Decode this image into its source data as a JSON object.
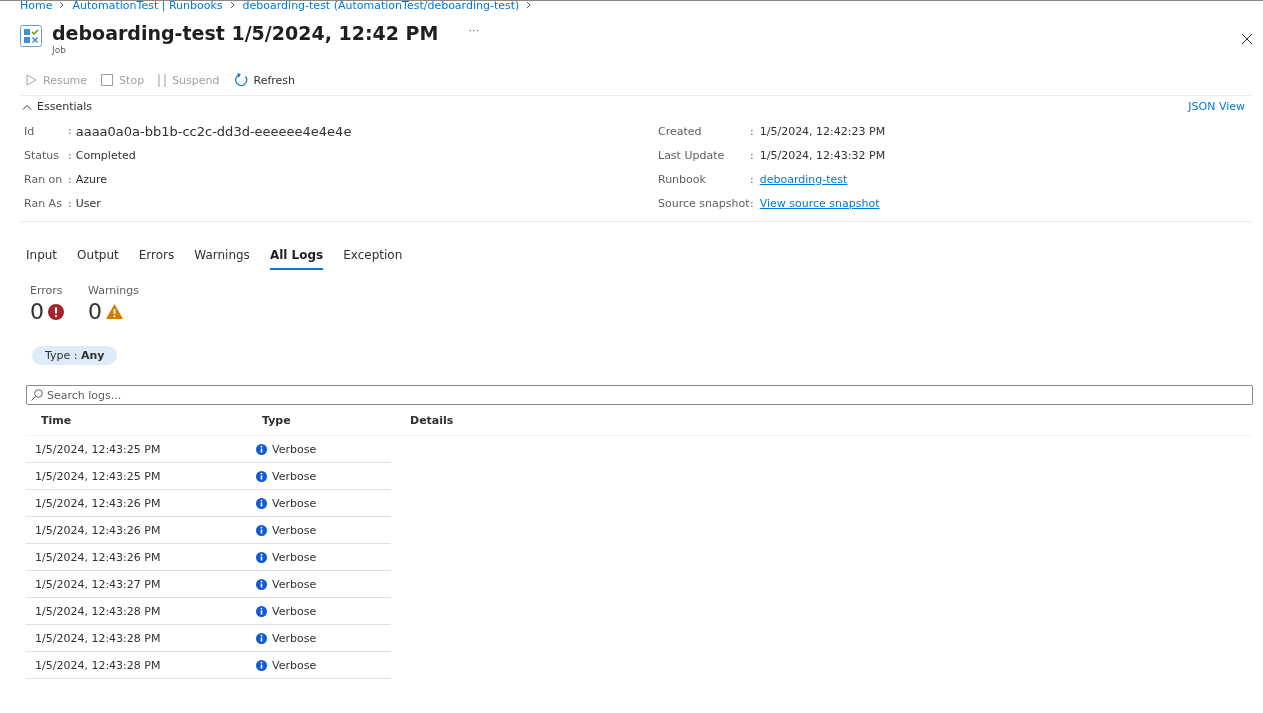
{
  "breadcrumb": [
    "Home",
    "AutomationTest | Runbooks",
    "deboarding-test (AutomationTest/deboarding-test)"
  ],
  "header": {
    "title": "deboarding-test 1/5/2024, 12:42 PM",
    "subtitle": "Job",
    "more": "···"
  },
  "toolbar": [
    {
      "kind": "resume",
      "label": "Resume",
      "disabled": true
    },
    {
      "kind": "stop",
      "label": "Stop",
      "disabled": true
    },
    {
      "kind": "suspend",
      "label": "Suspend",
      "disabled": true
    },
    {
      "kind": "refresh",
      "label": "Refresh",
      "disabled": false
    }
  ],
  "essentials": {
    "label": "Essentials",
    "expanded": true,
    "json_view": "JSON View",
    "separator": ":",
    "left": [
      {
        "label": "Id",
        "value": "aaaa0a0a-bb1b-cc2c-dd3d-eeeeee4e4e4e",
        "kind": "id"
      },
      {
        "label": "Status",
        "value": "Completed",
        "kind": "text"
      },
      {
        "label": "Ran on",
        "value": "Azure",
        "kind": "text"
      },
      {
        "label": "Ran As",
        "value": "User",
        "kind": "text"
      }
    ],
    "right": [
      {
        "label": "Created",
        "value": "1/5/2024, 12:42:23 PM",
        "kind": "text"
      },
      {
        "label": "Last Update",
        "value": "1/5/2024, 12:43:32 PM",
        "kind": "text"
      },
      {
        "label": "Runbook",
        "value": "deboarding-test",
        "kind": "link"
      },
      {
        "label": "Source snapshot",
        "value": "View source snapshot",
        "kind": "link"
      }
    ]
  },
  "tabs": [
    {
      "label": "Input",
      "selected": false
    },
    {
      "label": "Output",
      "selected": false
    },
    {
      "label": "Errors",
      "selected": false
    },
    {
      "label": "Warnings",
      "selected": false
    },
    {
      "label": "All Logs",
      "selected": true
    },
    {
      "label": "Exception",
      "selected": false
    }
  ],
  "counts": [
    {
      "kind": "error",
      "label": "Errors",
      "value": "0"
    },
    {
      "kind": "warning",
      "label": "Warnings",
      "value": "0"
    }
  ],
  "filter": {
    "text": "Type : **Any**"
  },
  "search": {
    "placeholder": "Search logs..."
  },
  "table": {
    "columns": [
      "Time",
      "Type",
      "Details"
    ],
    "rows": [
      {
        "time": "1/5/2024, 12:43:25 PM",
        "type": "Verbose"
      },
      {
        "time": "1/5/2024, 12:43:25 PM",
        "type": "Verbose"
      },
      {
        "time": "1/5/2024, 12:43:26 PM",
        "type": "Verbose"
      },
      {
        "time": "1/5/2024, 12:43:26 PM",
        "type": "Verbose"
      },
      {
        "time": "1/5/2024, 12:43:26 PM",
        "type": "Verbose"
      },
      {
        "time": "1/5/2024, 12:43:27 PM",
        "type": "Verbose"
      },
      {
        "time": "1/5/2024, 12:43:28 PM",
        "type": "Verbose"
      },
      {
        "time": "1/5/2024, 12:43:28 PM",
        "type": "Verbose"
      },
      {
        "time": "1/5/2024, 12:43:28 PM",
        "type": "Verbose"
      }
    ]
  }
}
